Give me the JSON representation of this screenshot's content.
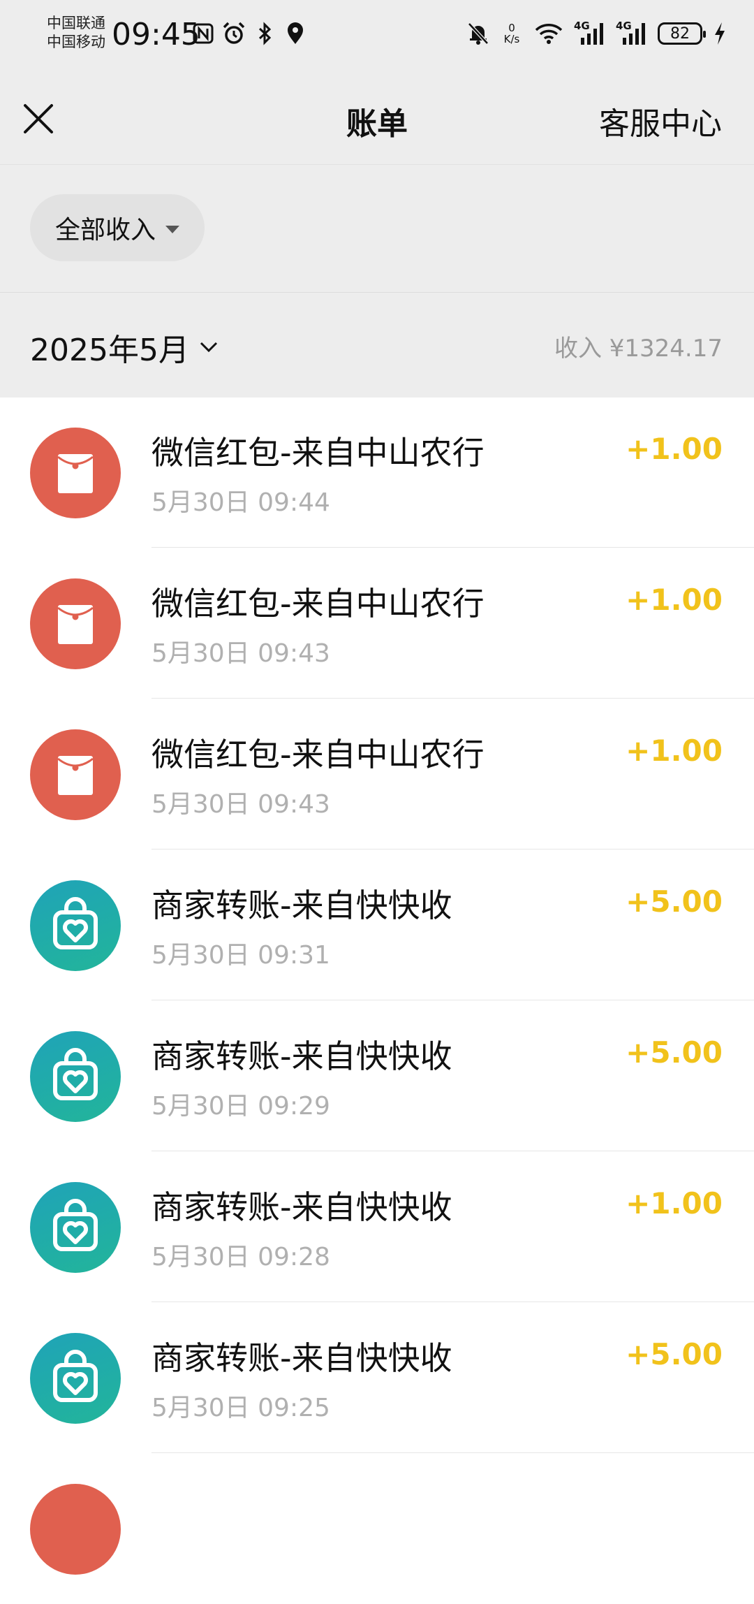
{
  "status_bar": {
    "carrier_1": "中国联通",
    "carrier_2": "中国移动",
    "time": "09:45",
    "network_speed_value": "0",
    "network_speed_unit": "K/s",
    "signal_1": "4G",
    "signal_2": "4G",
    "battery": "82"
  },
  "header": {
    "title": "账单",
    "service_label": "客服中心"
  },
  "filter": {
    "label": "全部收入"
  },
  "month": {
    "label": "2025年5月",
    "income_label": "收入 ¥1324.17"
  },
  "transactions": [
    {
      "title": "微信红包-来自中山农行",
      "time": "5月30日 09:44",
      "amount": "+1.00",
      "icon": "red-packet-icon"
    },
    {
      "title": "微信红包-来自中山农行",
      "time": "5月30日 09:43",
      "amount": "+1.00",
      "icon": "red-packet-icon"
    },
    {
      "title": "微信红包-来自中山农行",
      "time": "5月30日 09:43",
      "amount": "+1.00",
      "icon": "red-packet-icon"
    },
    {
      "title": "商家转账-来自快快收",
      "time": "5月30日 09:31",
      "amount": "+5.00",
      "icon": "merchant-bag-icon"
    },
    {
      "title": "商家转账-来自快快收",
      "time": "5月30日 09:29",
      "amount": "+5.00",
      "icon": "merchant-bag-icon"
    },
    {
      "title": "商家转账-来自快快收",
      "time": "5月30日 09:28",
      "amount": "+1.00",
      "icon": "merchant-bag-icon"
    },
    {
      "title": "商家转账-来自快快收",
      "time": "5月30日 09:25",
      "amount": "+5.00",
      "icon": "merchant-bag-icon"
    }
  ],
  "colors": {
    "background_gray": "#ededed",
    "amount_yellow": "#f1c21b",
    "red_packet": "#e0604f",
    "merchant_teal": "#1fa3b8"
  }
}
